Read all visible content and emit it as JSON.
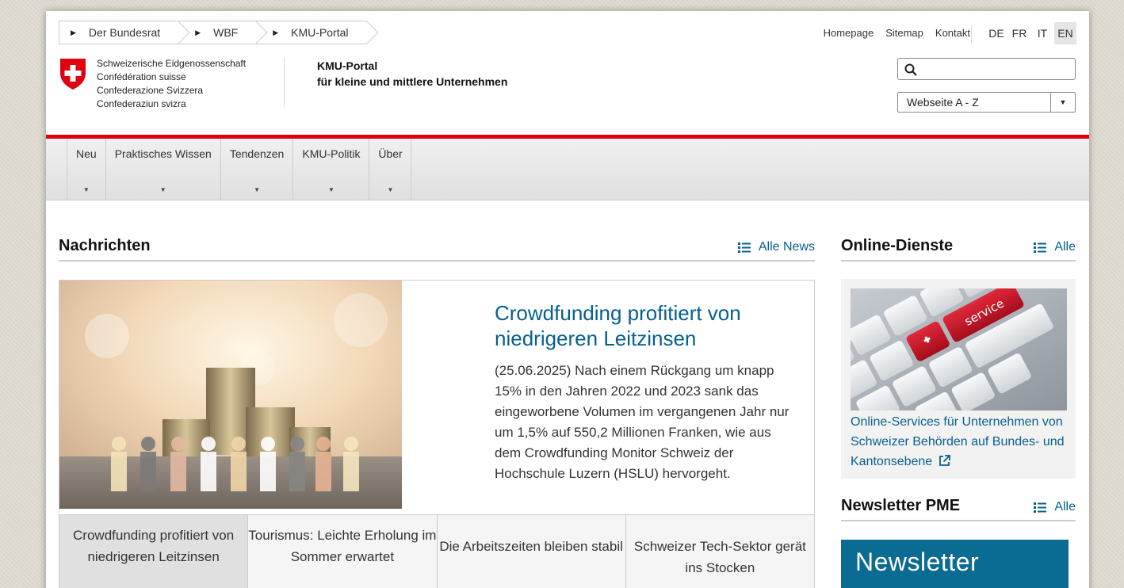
{
  "breadcrumb": [
    "Der Bundesrat",
    "WBF",
    "KMU-Portal"
  ],
  "toplinks": {
    "homepage": "Homepage",
    "sitemap": "Sitemap",
    "kontakt": "Kontakt"
  },
  "languages": [
    "DE",
    "FR",
    "IT",
    "EN"
  ],
  "active_language": "EN",
  "confederation": [
    "Schweizerische Eidgenossenschaft",
    "Confédération suisse",
    "Confederazione Svizzera",
    "Confederaziun svizra"
  ],
  "portal": {
    "title": "KMU-Portal",
    "subtitle": "für kleine und mittlere Unternehmen"
  },
  "search": {
    "placeholder": "",
    "value": ""
  },
  "site_select": {
    "selected": "Webseite A - Z"
  },
  "nav": [
    "Neu",
    "Praktisches Wissen",
    "Tendenzen",
    "KMU-Politik",
    "Über"
  ],
  "news": {
    "heading": "Nachrichten",
    "all_link": "Alle News",
    "featured": {
      "title": "Crowdfunding profitiert von niedrigeren Leitzinsen",
      "body": "(25.06.2025) Nach einem Rückgang um knapp 15% in den Jahren 2022 und 2023 sank das eingeworbene Volumen im vergangenen Jahr nur um 1,5% auf 550,2 Millionen Franken, wie aus dem Crowdfunding Monitor Schweiz der Hochschule Luzern (HSLU) hervorgeht."
    },
    "tabs": [
      "Crowdfunding profitiert von niedrigeren Leitzinsen",
      "Tourismus: Leichte Erholung im Sommer erwartet",
      "Die Arbeitszeiten bleiben stabil",
      "Schweizer Tech-Sektor gerät ins Stocken"
    ]
  },
  "online_services": {
    "heading": "Online-Dienste",
    "all_link": "Alle",
    "key_label": "service",
    "link_text": "Online-Services für Unternehmen von Schweizer Behörden auf Bundes- und Kantonsebene"
  },
  "newsletter": {
    "heading": "Newsletter PME",
    "all_link": "Alle",
    "banner": "Newsletter"
  },
  "colors": {
    "accent_red": "#e10010",
    "link_blue": "#06608e",
    "newsletter_blue": "#0a6b93"
  }
}
